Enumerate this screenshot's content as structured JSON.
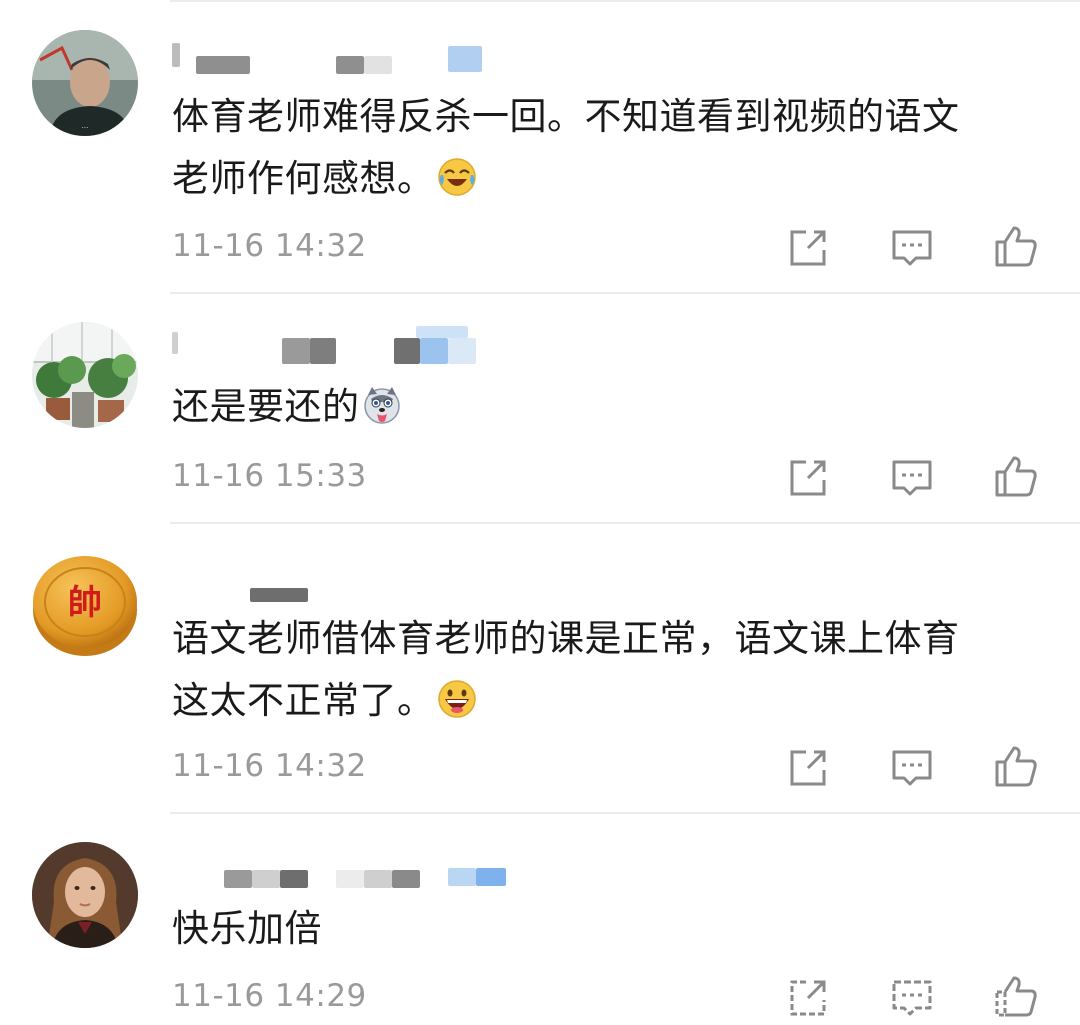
{
  "comments": [
    {
      "avatar": "portrait-avatar",
      "text": "体育老师难得反杀一回。不知道看到视频的语文老师作何感想。",
      "text_line1": "体育老师难得反杀一回。不知道看到视频的语文",
      "text_line2": "老师作何感想。",
      "emoji": "laughing-crying-emoji",
      "timestamp": "11-16 14:32"
    },
    {
      "avatar": "plants-avatar",
      "text_line1": "还是要还的",
      "emoji": "husky-dog-emoji",
      "timestamp": "11-16 15:33"
    },
    {
      "avatar": "chess-piece-avatar",
      "avatar_label": "帥",
      "text": "语文老师借体育老师的课是正常，语文课上体育这太不正常了。",
      "text_line1": "语文老师借体育老师的课是正常，语文课上体育",
      "text_line2": "这太不正常了。",
      "emoji": "grinning-emoji",
      "timestamp": "11-16 14:32"
    },
    {
      "avatar": "girl-portrait-avatar",
      "text_line1": "快乐加倍",
      "timestamp": "11-16 14:29"
    }
  ],
  "actions": [
    "share-icon",
    "reply-icon",
    "like-icon"
  ],
  "colors": {
    "text": "#1a1a1a",
    "meta": "#9a9a9a",
    "divider": "#ececec",
    "icon": "#8a8a8a",
    "blur_gray": "#8f8f8f",
    "blur_light": "#d8d8d8",
    "blur_blue": "#9cc3ee"
  }
}
